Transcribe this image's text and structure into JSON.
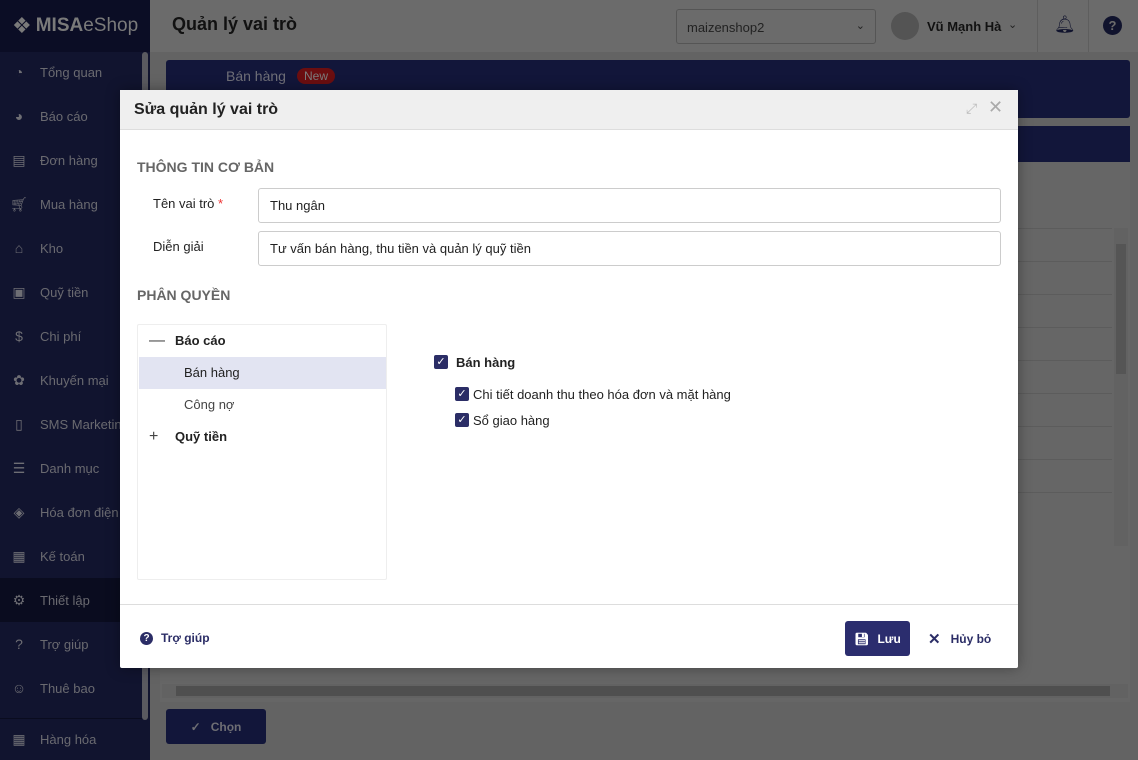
{
  "app": {
    "logo_brand": "MISA",
    "logo_product": "eShop",
    "page_title": "Quản lý vai trò"
  },
  "header": {
    "shop_select": "maizenshop2",
    "user_name": "Vũ Mạnh Hà"
  },
  "sidebar": {
    "items": [
      {
        "label": "Tổng quan",
        "icon": "dashboard-icon"
      },
      {
        "label": "Báo cáo",
        "icon": "pie-chart-icon"
      },
      {
        "label": "Đơn hàng",
        "icon": "order-icon"
      },
      {
        "label": "Mua hàng",
        "icon": "cart-icon"
      },
      {
        "label": "Kho",
        "icon": "warehouse-icon"
      },
      {
        "label": "Quỹ tiền",
        "icon": "safe-icon"
      },
      {
        "label": "Chi phí",
        "icon": "money-bag-icon"
      },
      {
        "label": "Khuyến mại",
        "icon": "gift-icon"
      },
      {
        "label": "SMS Marketing",
        "icon": "phone-icon"
      },
      {
        "label": "Danh mục",
        "icon": "list-icon"
      },
      {
        "label": "Hóa đơn điện tử",
        "icon": "invoice-icon"
      },
      {
        "label": "Kế toán",
        "icon": "calculator-icon"
      },
      {
        "label": "Thiết lập",
        "icon": "gear-icon",
        "active": true
      },
      {
        "label": "Trợ giúp",
        "icon": "help-icon"
      },
      {
        "label": "Thuê bao",
        "icon": "user-icon"
      }
    ],
    "bottom_item": {
      "label": "Hàng hóa",
      "icon": "boxes-icon"
    }
  },
  "background": {
    "banner_title": "Bán hàng",
    "banner_badge": "New",
    "choose_button": "Chọn"
  },
  "modal": {
    "title": "Sửa quản lý vai trò",
    "basic_section": "THÔNG TIN CƠ BẢN",
    "role_name_label": "Tên vai trò",
    "required_mark": "*",
    "role_name_value": "Thu ngân",
    "description_label": "Diễn giải",
    "description_value": "Tư vấn bán hàng, thu tiền và quản lý quỹ tiền",
    "permission_section": "PHÂN QUYỀN",
    "tree": [
      {
        "label": "Báo cáo",
        "toggle": "—"
      },
      {
        "label": "Bán hàng",
        "selected": true
      },
      {
        "label": "Công nợ"
      },
      {
        "label": "Quỹ tiền",
        "toggle": "+"
      }
    ],
    "permissions": {
      "group": {
        "label": "Bán hàng",
        "checked": true
      },
      "items": [
        {
          "label": "Chi tiết doanh thu theo hóa đơn và mặt hàng",
          "checked": true
        },
        {
          "label": "Sổ giao hàng",
          "checked": true
        }
      ]
    },
    "help_label": "Trợ giúp",
    "save_label": "Lưu",
    "cancel_label": "Hủy bỏ"
  },
  "colors": {
    "primary": "#2b2d6e",
    "sidebar": "#11142f",
    "overlay": "#636363"
  }
}
